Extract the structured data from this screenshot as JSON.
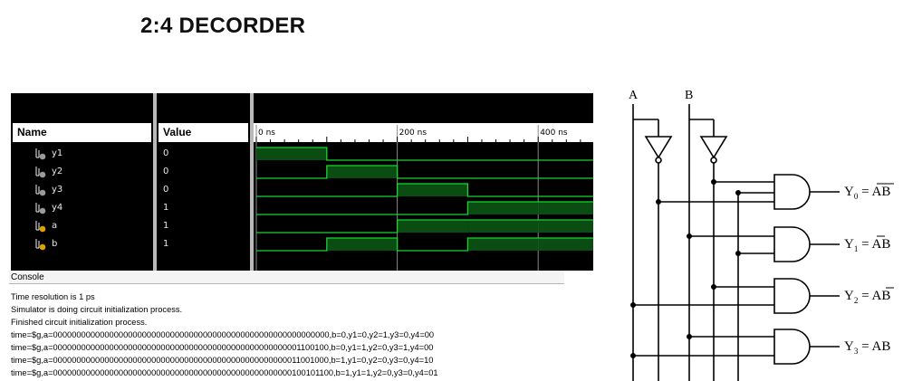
{
  "page": {
    "title": "2:4 DECORDER"
  },
  "simulator": {
    "headers": {
      "name": "Name",
      "value": "Value"
    },
    "signals": [
      {
        "name": "y1",
        "value": "0",
        "kind": "output",
        "levels": [
          1,
          0,
          0,
          0,
          0
        ]
      },
      {
        "name": "y2",
        "value": "0",
        "kind": "output",
        "levels": [
          0,
          1,
          0,
          0,
          0
        ]
      },
      {
        "name": "y3",
        "value": "0",
        "kind": "output",
        "levels": [
          0,
          0,
          1,
          0,
          0
        ]
      },
      {
        "name": "y4",
        "value": "1",
        "kind": "output",
        "levels": [
          0,
          0,
          0,
          1,
          1
        ]
      },
      {
        "name": "a",
        "value": "1",
        "kind": "input",
        "levels": [
          0,
          0,
          1,
          1,
          1
        ]
      },
      {
        "name": "b",
        "value": "1",
        "kind": "input",
        "levels": [
          0,
          1,
          0,
          1,
          1
        ]
      }
    ],
    "time_axis": {
      "labels": [
        "0 ns",
        "200 ns",
        "400 ns"
      ],
      "label_times": [
        0,
        200,
        400
      ],
      "step_ns": 100,
      "visible_ns": 480
    },
    "colors": {
      "wave_high_fill": "#0a4d12",
      "wave_line": "#19d430",
      "background": "#000000"
    }
  },
  "console": {
    "tab_label": "Console",
    "lines": [
      "Time resolution is 1 ps",
      "Simulator is doing circuit initialization process.",
      "Finished circuit initialization process.",
      "time=$g,a=00000000000000000000000000000000000000000000000000000000000,b=0,y1=0,y2=1,y3=0,y4=00",
      "time=$g,a=00000000000000000000000000000000000000000000000000001100100,b=0,y1=1,y2=0,y3=1,y4=00",
      "time=$g,a=00000000000000000000000000000000000000000000000000011001000,b=1,y1=0,y2=0,y3=0,y4=10",
      "time=$g,a=000000000000000000000000000000000000000000000000000100101100,b=1,y1=1,y2=0,y3=0,y4=01"
    ]
  },
  "circuit": {
    "inputs": [
      "A",
      "B"
    ],
    "outputs": [
      {
        "label": "Y",
        "sub": "0",
        "expr": "AB",
        "bar": "both"
      },
      {
        "label": "Y",
        "sub": "1",
        "expr": "AB",
        "bar": "A"
      },
      {
        "label": "Y",
        "sub": "2",
        "expr": "AB",
        "bar": "B"
      },
      {
        "label": "Y",
        "sub": "3",
        "expr": "AB",
        "bar": "none"
      }
    ]
  }
}
